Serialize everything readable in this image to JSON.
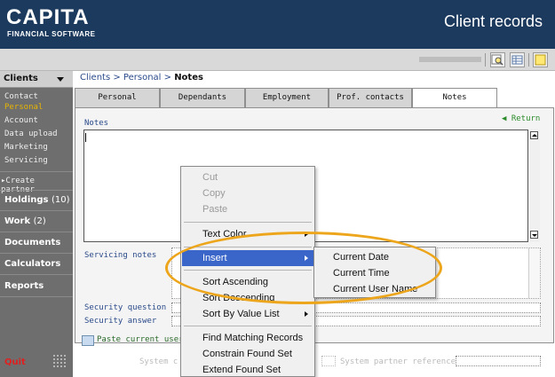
{
  "header": {
    "logo_main": "CAPITA",
    "logo_sub": "FINANCIAL SOFTWARE",
    "app_title": "Client records"
  },
  "sidebar": {
    "header_label": "Clients",
    "links": [
      "Contact",
      "Personal",
      "Account",
      "Data upload",
      "Marketing",
      "Servicing"
    ],
    "active_link": "Personal",
    "create_partner": "Create partner",
    "holdings_label": "Holdings",
    "holdings_count": "(10)",
    "work_label": "Work",
    "work_count": "(2)",
    "documents": "Documents",
    "calculators": "Calculators",
    "reports": "Reports",
    "quit": "Quit"
  },
  "breadcrumb": {
    "part1": "Clients",
    "sep": " > ",
    "part2": "Personal",
    "current": "Notes"
  },
  "tabs": [
    "Personal",
    "Dependants",
    "Employment",
    "Prof. contacts",
    "Notes"
  ],
  "active_tab": "Notes",
  "notes": {
    "label": "Notes",
    "return": "Return"
  },
  "form": {
    "servicing_notes": "Servicing notes",
    "security_question": "Security question",
    "security_answer": "Security answer",
    "paste_current_user": "Paste current user",
    "system_client_ref": "System c",
    "system_partner_ref": "System partner reference"
  },
  "context_menu": {
    "cut": "Cut",
    "copy": "Copy",
    "paste": "Paste",
    "text_color": "Text Color",
    "insert": "Insert",
    "sort_ascending": "Sort Ascending",
    "sort_descending": "Sort Descending",
    "sort_by_value_list": "Sort By Value List",
    "find_matching": "Find Matching Records",
    "constrain": "Constrain Found Set",
    "extend": "Extend Found Set"
  },
  "insert_submenu": {
    "current_date": "Current Date",
    "current_time": "Current Time",
    "current_user_name": "Current User Name"
  },
  "colors": {
    "header_bg": "#1c3a5e",
    "sidebar_bg": "#6e6e6e",
    "active_link": "#e8b400",
    "menu_highlight": "#3a66c9",
    "ring": "#eda61c",
    "quit": "#e02020"
  }
}
